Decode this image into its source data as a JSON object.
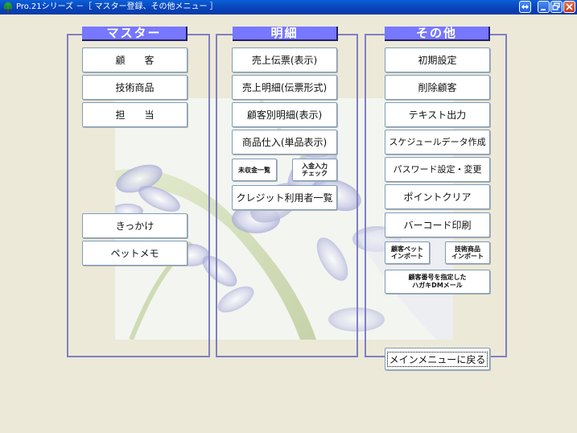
{
  "window": {
    "title": "Pro.21シリーズ  －［ マスター登録、その他メニュー ］"
  },
  "panels": {
    "master": {
      "header": "マスター",
      "buttons": [
        "顧　　客",
        "技術商品",
        "担　　当",
        "きっかけ",
        "ペットメモ"
      ]
    },
    "detail": {
      "header": "明細",
      "buttons": [
        "売上伝票(表示)",
        "売上明細(伝票形式)",
        "顧客別明細(表示)",
        "商品仕入(単品表示)",
        "未収金一覧",
        "入金入力\nチェック",
        "クレジット利用者一覧"
      ]
    },
    "other": {
      "header": "その他",
      "buttons": [
        "初期設定",
        "削除顧客",
        "テキスト出力",
        "スケジュールデータ作成",
        "パスワード設定・変更",
        "ポイントクリア",
        "バーコード印刷",
        "顧客ペット\nインポート",
        "技術商品\nインポート",
        "顧客番号を指定した\nハガキDMメール"
      ]
    }
  },
  "back_button": "メインメニューに戻る"
}
